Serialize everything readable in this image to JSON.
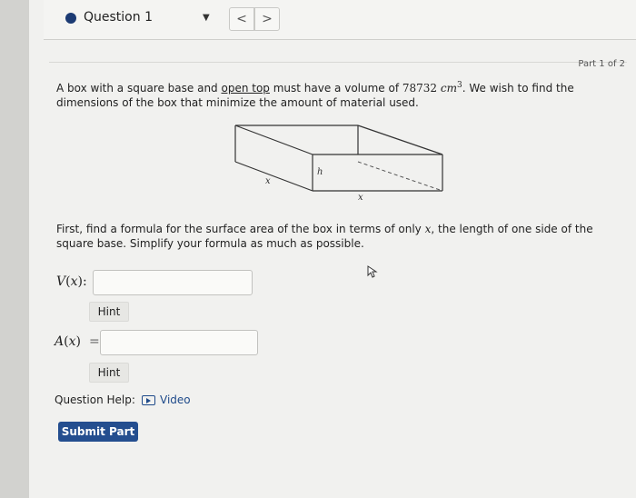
{
  "nav": {
    "question_label": "Question 1",
    "prev": "<",
    "next": ">"
  },
  "part": {
    "label": "Part 1 of 2"
  },
  "problem": {
    "text_1": "A box with a square base and ",
    "underlined": "open top",
    "text_2": " must have a volume of ",
    "volume_value": "78732",
    "volume_unit": "cm",
    "volume_exp": "3",
    "text_3": ". We wish to find the dimensions of the box that minimize the amount of material used."
  },
  "figure": {
    "label_x_front": "x",
    "label_h": "h",
    "label_x_side": "x"
  },
  "instruction": {
    "text_1": "First, find a formula for the surface area of the box in terms of only ",
    "var": "x",
    "text_2": ", the length of one side of the square base. Simplify your formula as much as possible."
  },
  "volume_field": {
    "fn": "V",
    "arg": "x",
    "value": ""
  },
  "area_field": {
    "fn": "A",
    "arg": "x",
    "value": ""
  },
  "hint_label": "Hint",
  "help": {
    "label": "Question Help:",
    "video": "Video"
  },
  "submit_label": "Submit Part",
  "colors": {
    "accent": "#244e8f",
    "link": "#1e4a8a"
  }
}
